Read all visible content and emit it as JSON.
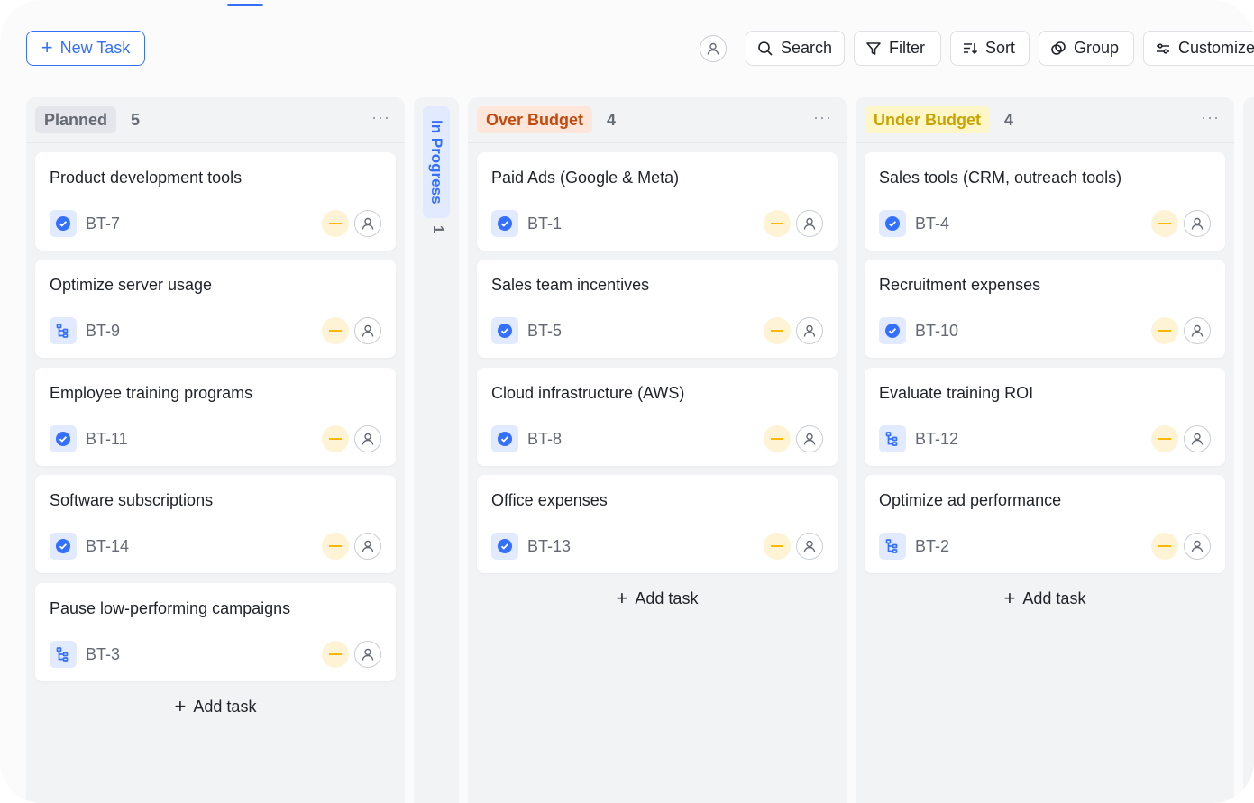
{
  "toolbar": {
    "new_task_label": "New Task",
    "buttons": {
      "search": "Search",
      "filter": "Filter",
      "sort": "Sort",
      "group": "Group",
      "customize": "Customize"
    }
  },
  "colors": {
    "accent": "#3370ff",
    "planned_pill_bg": "#e5e6eb",
    "over_budget_pill_bg": "#fee7da",
    "over_budget_text": "#c34a0c",
    "under_budget_pill_bg": "#fdf6c8",
    "under_budget_text": "#c9a400",
    "priority": "#ffb800"
  },
  "columns": [
    {
      "name": "Planned",
      "count": "5",
      "cards": [
        {
          "title": "Product development tools",
          "id": "BT-7",
          "icon": "check-circle-icon"
        },
        {
          "title": "Optimize server usage",
          "id": "BT-9",
          "icon": "subtask-icon"
        },
        {
          "title": "Employee training programs",
          "id": "BT-11",
          "icon": "check-circle-icon"
        },
        {
          "title": "Software subscriptions",
          "id": "BT-14",
          "icon": "check-circle-icon"
        },
        {
          "title": "Pause low-performing campaigns",
          "id": "BT-3",
          "icon": "subtask-icon"
        }
      ],
      "add_task": "Add task"
    },
    {
      "name": "In Progress",
      "count": "1",
      "collapsed": true
    },
    {
      "name": "Over Budget",
      "count": "4",
      "cards": [
        {
          "title": "Paid Ads (Google & Meta)",
          "id": "BT-1",
          "icon": "check-circle-icon"
        },
        {
          "title": "Sales team incentives",
          "id": "BT-5",
          "icon": "check-circle-icon"
        },
        {
          "title": "Cloud infrastructure (AWS)",
          "id": "BT-8",
          "icon": "check-circle-icon"
        },
        {
          "title": "Office expenses",
          "id": "BT-13",
          "icon": "check-circle-icon"
        }
      ],
      "add_task": "Add task"
    },
    {
      "name": "Under Budget",
      "count": "4",
      "cards": [
        {
          "title": "Sales tools (CRM, outreach tools)",
          "id": "BT-4",
          "icon": "check-circle-icon"
        },
        {
          "title": "Recruitment expenses",
          "id": "BT-10",
          "icon": "check-circle-icon"
        },
        {
          "title": "Evaluate training ROI",
          "id": "BT-12",
          "icon": "subtask-icon"
        },
        {
          "title": "Optimize ad performance",
          "id": "BT-2",
          "icon": "subtask-icon"
        }
      ],
      "add_task": "Add task"
    }
  ]
}
